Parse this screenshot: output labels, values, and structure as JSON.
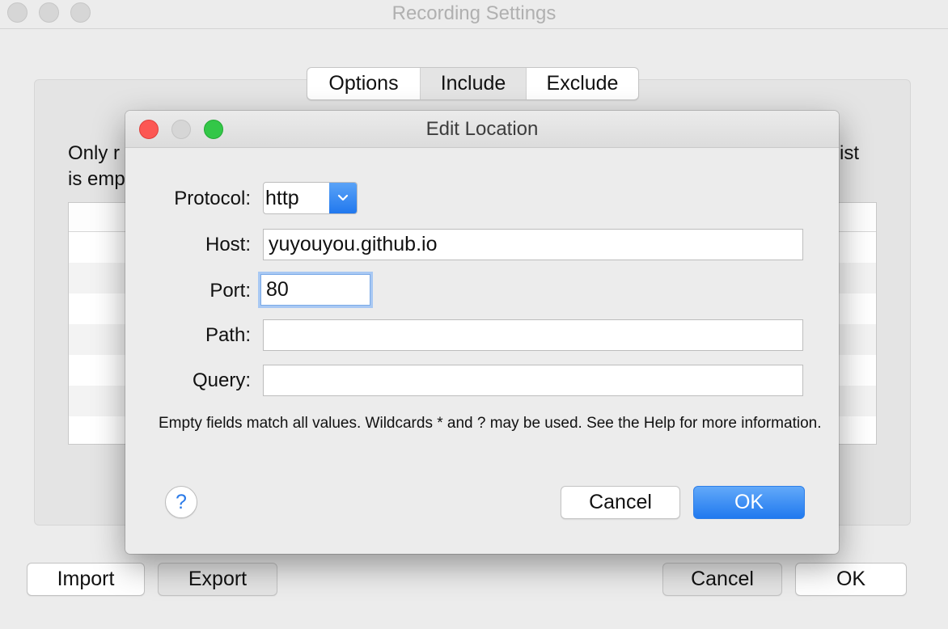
{
  "window": {
    "title": "Recording Settings",
    "tabs": [
      {
        "label": "Options"
      },
      {
        "label": "Include"
      },
      {
        "label": "Exclude"
      }
    ],
    "panel_text_left_line1": "Only r",
    "panel_text_left_line2": "is emp",
    "panel_text_right_line1": "ist",
    "buttons": {
      "import": "Import",
      "export": "Export",
      "cancel": "Cancel",
      "ok": "OK"
    }
  },
  "dialog": {
    "title": "Edit Location",
    "fields": {
      "protocol": {
        "label": "Protocol:",
        "value": "http"
      },
      "host": {
        "label": "Host:",
        "value": "yuyouyou.github.io"
      },
      "port": {
        "label": "Port:",
        "value": "80"
      },
      "path": {
        "label": "Path:",
        "value": ""
      },
      "query": {
        "label": "Query:",
        "value": ""
      }
    },
    "hint": "Empty fields match all values. Wildcards * and ? may be used. See the Help for more information.",
    "help_label": "?",
    "buttons": {
      "cancel": "Cancel",
      "ok": "OK"
    }
  },
  "colors": {
    "close": "#fc5753",
    "minimize": "#d6d6d6",
    "zoom": "#33c748",
    "accent": "#2a7ae8",
    "inactive_traffic": "#d6d6d6"
  }
}
